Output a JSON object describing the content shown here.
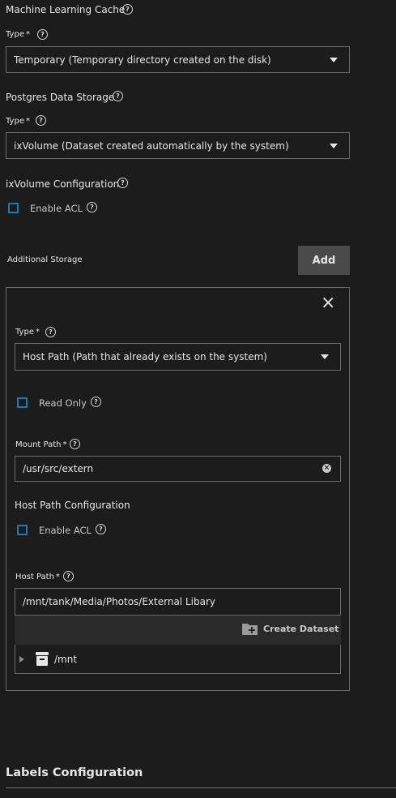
{
  "ml_cache": {
    "title": "Machine Learning Cache",
    "type_label": "Type",
    "required_mark": "*",
    "type_value": "Temporary (Temporary directory created on the disk)"
  },
  "postgres": {
    "title": "Postgres Data Storage",
    "type_label": "Type",
    "required_mark": "*",
    "type_value": "ixVolume (Dataset created automatically by the system)"
  },
  "ixvolume_config": {
    "title": "ixVolume Configuration",
    "enable_acl_label": "Enable ACL"
  },
  "additional_storage": {
    "title": "Additional Storage",
    "add_label": "Add",
    "close_symbol": "×",
    "item": {
      "type_label": "Type",
      "required_mark": "*",
      "type_value": "Host Path (Path that already exists on the system)",
      "read_only_label": "Read Only",
      "mount_path_label": "Mount Path",
      "mount_path_value": "/usr/src/extern",
      "host_path_config_title": "Host Path Configuration",
      "enable_acl_label": "Enable ACL",
      "host_path_label": "Host Path",
      "host_path_value": "/mnt/tank/Media/Photos/External Libary",
      "create_dataset_label": "Create Dataset",
      "tree_root": "/mnt"
    }
  },
  "labels_config": {
    "title": "Labels Configuration"
  },
  "icons": {
    "help": "help-circle-icon",
    "caret": "caret-down-icon",
    "close": "close-icon",
    "clear": "clear-circle-icon",
    "folder_add": "folder-plus-icon",
    "dataset": "dataset-stack-icon",
    "tree_expand": "triangle-right-icon"
  },
  "colors": {
    "background": "#1c1c1c",
    "checkbox_border": "#1f78b4",
    "button_bg": "#4a4a4a"
  }
}
